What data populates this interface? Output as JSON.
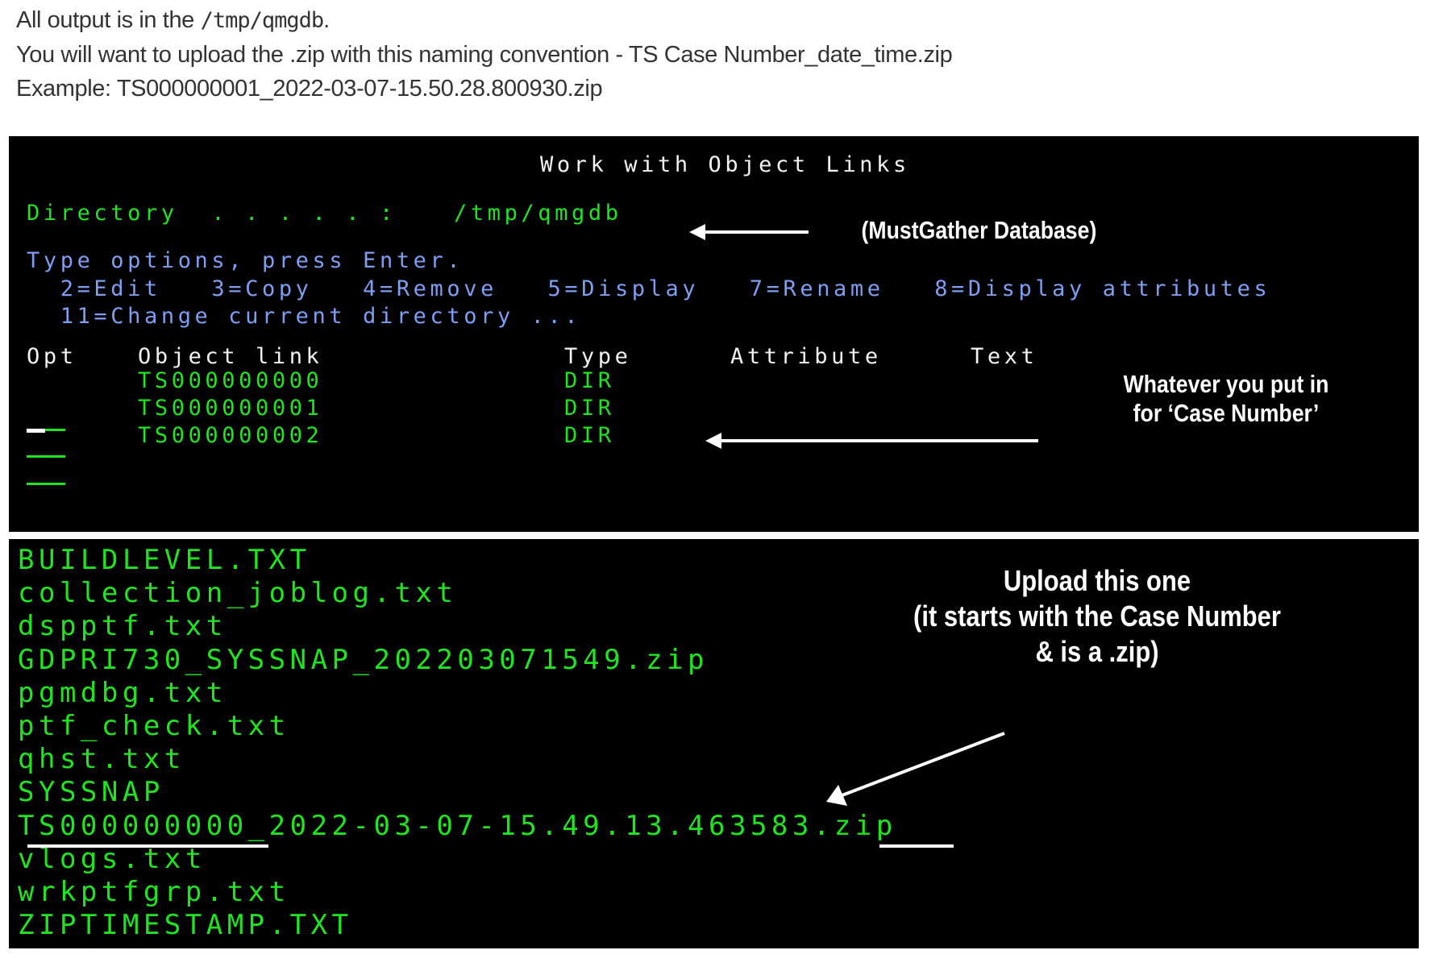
{
  "intro": {
    "line1_prefix": "All output is in the ",
    "line1_path": "/tmp/qmgdb",
    "line1_suffix": ".",
    "line2": "You will want to upload the .zip with this naming convention - TS Case Number_date_time.zip",
    "line3": "Example: TS000000001_2022-03-07-15.50.28.800930.zip"
  },
  "screen": {
    "title": "Work with Object Links",
    "directory_label": "Directory  . . . . . :",
    "directory_value": "/tmp/qmgdb",
    "instructions": "Type options, press Enter.",
    "options_line1": "  2=Edit   3=Copy   4=Remove   5=Display   7=Rename   8=Display attributes",
    "options_line2": "  11=Change current directory ...",
    "columns": {
      "opt": "Opt",
      "object_link": "Object link",
      "type": "Type",
      "attribute": "Attribute",
      "text": "Text"
    },
    "rows": [
      {
        "opt": "",
        "object_link": "TS000000000",
        "type": "DIR",
        "attribute": "",
        "text": ""
      },
      {
        "opt": "",
        "object_link": "TS000000001",
        "type": "DIR",
        "attribute": "",
        "text": ""
      },
      {
        "opt": "",
        "object_link": "TS000000002",
        "type": "DIR",
        "attribute": "",
        "text": ""
      }
    ]
  },
  "annotations": {
    "directory_note": "(MustGather Database)",
    "case_number_note": "Whatever you put in\nfor ‘Case Number’",
    "upload_note": "Upload this one\n(it starts with the Case Number\n& is a .zip)"
  },
  "files": [
    "BUILDLEVEL.TXT",
    "collection_joblog.txt",
    "dspptf.txt",
    "GDPRI730_SYSSNAP_202203071549.zip",
    "pgmdbg.txt",
    "ptf_check.txt",
    "qhst.txt",
    "SYSSNAP",
    "TS000000000_2022-03-07-15.49.13.463583.zip",
    "vlogs.txt",
    "wrkptfgrp.txt",
    "ZIPTIMESTAMP.TXT"
  ],
  "colors": {
    "terminal_bg": "#000000",
    "field_green": "#1fe41f",
    "prompt_blue": "#7f9ef2",
    "heading_white": "#f2f2f2",
    "annotation_white": "#ffffff"
  }
}
